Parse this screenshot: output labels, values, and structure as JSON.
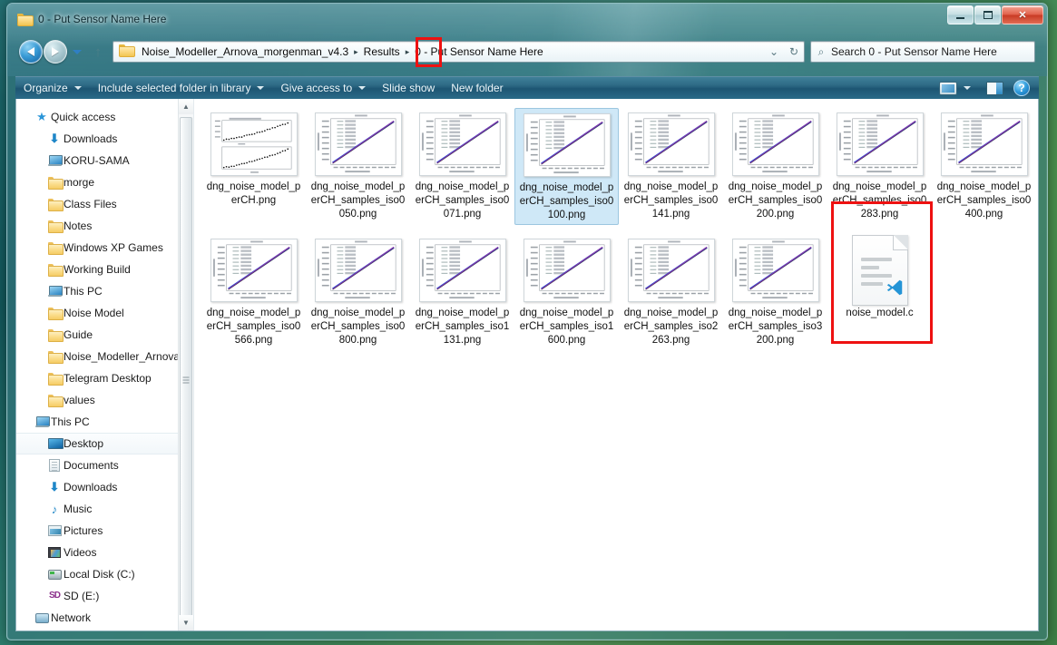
{
  "window": {
    "title": "0 - Put Sensor Name Here",
    "title_icon": "folder-icon",
    "buttons": {
      "minimize": "minimize-icon",
      "maximize": "maximize-icon",
      "close": "✕"
    }
  },
  "navigation": {
    "back": "back-arrow-icon",
    "forward": "forward-arrow-icon",
    "recent": "chevron-down-icon",
    "up": "up-arrow-icon"
  },
  "address_bar": {
    "folder_icon": "folder-icon",
    "crumbs": [
      "Noise_Modeller_Arnova_morgenman_v4.3",
      "Results"
    ],
    "current": "0 - Put Sensor Name Here",
    "separator": "▸",
    "dropdown": "chevron-down-icon",
    "refresh": "↻"
  },
  "search": {
    "icon": "search-icon",
    "placeholder": "Search 0 - Put Sensor Name Here"
  },
  "command_bar": {
    "items": [
      {
        "label": "Organize",
        "dropdown": true
      },
      {
        "label": "Include selected folder in library",
        "dropdown": true
      },
      {
        "label": "Give access to",
        "dropdown": true
      },
      {
        "label": "Slide show",
        "dropdown": false
      },
      {
        "label": "New folder",
        "dropdown": false
      }
    ],
    "view_icon": "view-layout-icon",
    "view_caret": "chevron-down-icon",
    "preview_pane_icon": "preview-pane-icon",
    "help_icon": "?"
  },
  "sidebar": {
    "items": [
      {
        "label": "Quick access",
        "icon": "star-icon",
        "indent": 0,
        "pinned": false,
        "selected": false
      },
      {
        "label": "Downloads",
        "icon": "download-icon",
        "indent": 1,
        "pinned": true,
        "selected": false
      },
      {
        "label": "KORU-SAMA",
        "icon": "computer-icon",
        "indent": 1,
        "pinned": true,
        "selected": false
      },
      {
        "label": "morge",
        "icon": "folder-icon",
        "indent": 1,
        "pinned": true,
        "selected": false
      },
      {
        "label": "Class Files",
        "icon": "folder-icon",
        "indent": 1,
        "pinned": true,
        "selected": false
      },
      {
        "label": "Notes",
        "icon": "folder-icon",
        "indent": 1,
        "pinned": true,
        "selected": false
      },
      {
        "label": "Windows XP Games",
        "icon": "folder-icon",
        "indent": 1,
        "pinned": true,
        "selected": false
      },
      {
        "label": "Working Build",
        "icon": "folder-icon",
        "indent": 1,
        "pinned": true,
        "selected": false
      },
      {
        "label": "This PC",
        "icon": "computer-icon",
        "indent": 1,
        "pinned": true,
        "selected": false
      },
      {
        "label": "Noise Model",
        "icon": "folder-icon",
        "indent": 1,
        "pinned": true,
        "selected": false
      },
      {
        "label": "Guide",
        "icon": "folder-icon",
        "indent": 1,
        "pinned": false,
        "selected": false
      },
      {
        "label": "Noise_Modeller_Arnova_",
        "icon": "folder-icon",
        "indent": 1,
        "pinned": false,
        "selected": false
      },
      {
        "label": "Telegram Desktop",
        "icon": "folder-icon",
        "indent": 1,
        "pinned": false,
        "selected": false
      },
      {
        "label": "values",
        "icon": "folder-icon",
        "indent": 1,
        "pinned": false,
        "selected": false
      },
      {
        "label": "This PC",
        "icon": "computer-icon",
        "indent": 0,
        "pinned": false,
        "selected": false
      },
      {
        "label": "Desktop",
        "icon": "desktop-icon",
        "indent": 1,
        "pinned": false,
        "selected": true
      },
      {
        "label": "Documents",
        "icon": "documents-icon",
        "indent": 1,
        "pinned": false,
        "selected": false
      },
      {
        "label": "Downloads",
        "icon": "download-icon",
        "indent": 1,
        "pinned": false,
        "selected": false
      },
      {
        "label": "Music",
        "icon": "music-icon",
        "indent": 1,
        "pinned": false,
        "selected": false
      },
      {
        "label": "Pictures",
        "icon": "pictures-icon",
        "indent": 1,
        "pinned": false,
        "selected": false
      },
      {
        "label": "Videos",
        "icon": "videos-icon",
        "indent": 1,
        "pinned": false,
        "selected": false
      },
      {
        "label": "Local Disk (C:)",
        "icon": "disk-icon",
        "indent": 1,
        "pinned": false,
        "selected": false
      },
      {
        "label": "SD (E:)",
        "icon": "sd-card-icon",
        "indent": 1,
        "pinned": false,
        "selected": false
      },
      {
        "label": "Network",
        "icon": "network-icon",
        "indent": 0,
        "pinned": false,
        "selected": false
      }
    ],
    "scrollbar": {
      "up": "▲",
      "down": "▼"
    }
  },
  "files": [
    {
      "name": "dng_noise_model_perCH.png",
      "type": "image",
      "thumb": "dual-scatter",
      "selected": false
    },
    {
      "name": "dng_noise_model_perCH_samples_iso0050.png",
      "type": "image",
      "thumb": "line-plot",
      "selected": false
    },
    {
      "name": "dng_noise_model_perCH_samples_iso0071.png",
      "type": "image",
      "thumb": "line-plot",
      "selected": false
    },
    {
      "name": "dng_noise_model_perCH_samples_iso0100.png",
      "type": "image",
      "thumb": "line-plot",
      "selected": true
    },
    {
      "name": "dng_noise_model_perCH_samples_iso0141.png",
      "type": "image",
      "thumb": "line-plot",
      "selected": false
    },
    {
      "name": "dng_noise_model_perCH_samples_iso0200.png",
      "type": "image",
      "thumb": "line-plot",
      "selected": false
    },
    {
      "name": "dng_noise_model_perCH_samples_iso0283.png",
      "type": "image",
      "thumb": "line-plot",
      "selected": false
    },
    {
      "name": "dng_noise_model_perCH_samples_iso0400.png",
      "type": "image",
      "thumb": "line-plot",
      "selected": false
    },
    {
      "name": "dng_noise_model_perCH_samples_iso0566.png",
      "type": "image",
      "thumb": "line-plot",
      "selected": false
    },
    {
      "name": "dng_noise_model_perCH_samples_iso0800.png",
      "type": "image",
      "thumb": "line-plot",
      "selected": false
    },
    {
      "name": "dng_noise_model_perCH_samples_iso1131.png",
      "type": "image",
      "thumb": "line-plot",
      "selected": false
    },
    {
      "name": "dng_noise_model_perCH_samples_iso1600.png",
      "type": "image",
      "thumb": "line-plot",
      "selected": false
    },
    {
      "name": "dng_noise_model_perCH_samples_iso2263.png",
      "type": "image",
      "thumb": "line-plot",
      "selected": false
    },
    {
      "name": "dng_noise_model_perCH_samples_iso3200.png",
      "type": "image",
      "thumb": "line-plot",
      "selected": false
    },
    {
      "name": "noise_model.c",
      "type": "code",
      "thumb": "c-file",
      "selected": false
    }
  ],
  "annotations": {
    "accent_color": "#ee1111",
    "boxes": [
      {
        "name": "breadcrumb-zero-highlight"
      },
      {
        "name": "noise-model-c-highlight"
      }
    ]
  }
}
